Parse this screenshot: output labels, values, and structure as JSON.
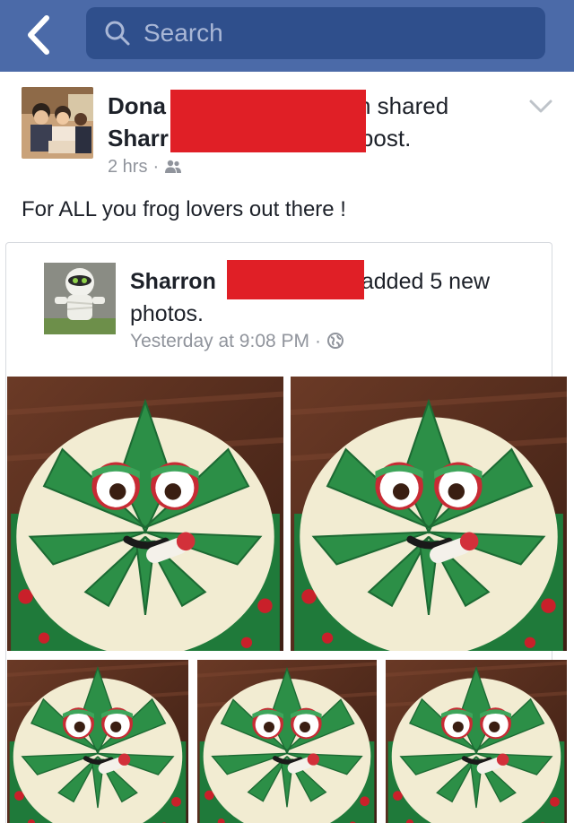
{
  "header": {
    "search_placeholder": "Search",
    "bar_color": "#4b6aa8"
  },
  "post": {
    "author_line1_start": "Dona",
    "author_line1_end": "n shared",
    "author_line2_start": "Sharr",
    "author_line2_end": "post.",
    "time": "2 hrs",
    "audience_icon": "friends-icon",
    "text": "For ALL you frog lovers out there !"
  },
  "shared": {
    "author_first": "Sharron",
    "action": "added 5 new",
    "action_cont": "photos.",
    "time": "Yesterday at 9:08 PM",
    "audience_icon": "globe-icon"
  },
  "photos": [
    {
      "label": "cake photo 1"
    },
    {
      "label": "cake photo 2"
    },
    {
      "label": "cake photo 3"
    },
    {
      "label": "cake photo 4"
    },
    {
      "label": "cake photo 5"
    }
  ]
}
